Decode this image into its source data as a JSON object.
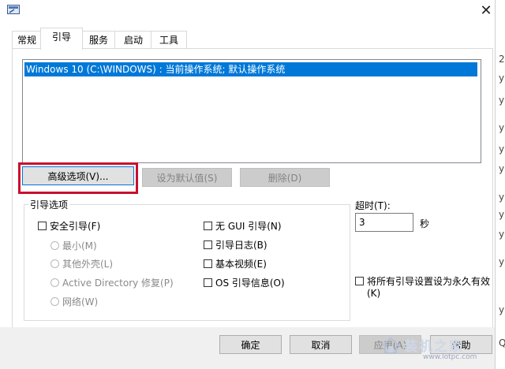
{
  "tabs": [
    "常规",
    "引导",
    "服务",
    "启动",
    "工具"
  ],
  "os_list": {
    "items": [
      "Windows 10 (C:\\WINDOWS) : 当前操作系统; 默认操作系统"
    ]
  },
  "buttons": {
    "advanced": "高级选项(V)...",
    "set_default": "设为默认值(S)",
    "delete": "删除(D)"
  },
  "boot_options": {
    "title": "引导选项",
    "safe_boot": "安全引导(F)",
    "minimal": "最小(M)",
    "alternate_shell": "其他外壳(L)",
    "active_directory": "Active Directory 修复(P)",
    "network": "网络(W)",
    "no_gui": "无 GUI 引导(N)",
    "boot_log": "引导日志(B)",
    "base_video": "基本视频(E)",
    "os_boot_info": "OS 引导信息(O)"
  },
  "timeout": {
    "label": "超时(T):",
    "value": "3",
    "unit": "秒"
  },
  "make_permanent": {
    "line1": "将所有引导设置设为永久有效",
    "line2": "(K)"
  },
  "dialog_buttons": {
    "ok": "确定",
    "cancel": "取消",
    "apply": "应用(A)",
    "help": "帮助"
  },
  "edge_chars": [
    "2",
    "y",
    "y",
    "y",
    "y",
    "y",
    "y",
    "y",
    "y",
    "y",
    "y",
    "Q"
  ],
  "watermark": {
    "text": "装机之家",
    "url": "www.lotpc.com"
  },
  "colors": {
    "selection": "#0078d7",
    "highlight_box": "#c8102e"
  }
}
